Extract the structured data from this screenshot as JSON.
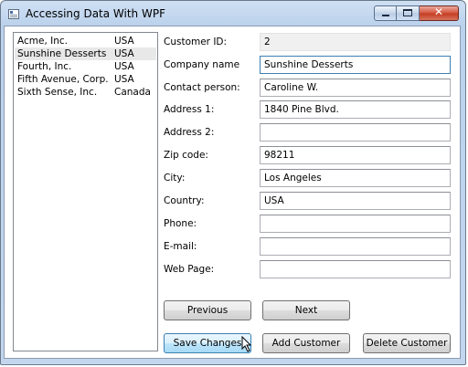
{
  "window": {
    "title": "Accessing Data With WPF"
  },
  "customers": [
    {
      "name": "Acme, Inc.",
      "country": "USA"
    },
    {
      "name": "Sunshine Desserts",
      "country": "USA"
    },
    {
      "name": "Fourth, Inc.",
      "country": "USA"
    },
    {
      "name": "Fifth Avenue, Corp.",
      "country": "USA"
    },
    {
      "name": "Sixth Sense, Inc.",
      "country": "Canada"
    }
  ],
  "selected_customer_index": 1,
  "form": {
    "customer_id": {
      "label": "Customer ID:",
      "value": "2"
    },
    "company_name": {
      "label": "Company name",
      "value": "Sunshine Desserts"
    },
    "contact_person": {
      "label": "Contact person:",
      "value": "Caroline W."
    },
    "address1": {
      "label": "Address 1:",
      "value": "1840 Pine Blvd."
    },
    "address2": {
      "label": "Address 2:",
      "value": ""
    },
    "zip": {
      "label": "Zip code:",
      "value": "98211"
    },
    "city": {
      "label": "City:",
      "value": "Los Angeles"
    },
    "country": {
      "label": "Country:",
      "value": "USA"
    },
    "phone": {
      "label": "Phone:",
      "value": ""
    },
    "email": {
      "label": "E-mail:",
      "value": ""
    },
    "web_page": {
      "label": "Web Page:",
      "value": ""
    }
  },
  "buttons": {
    "previous": "Previous",
    "next": "Next",
    "save": "Save Changes",
    "add": "Add Customer",
    "delete": "Delete Customer"
  }
}
